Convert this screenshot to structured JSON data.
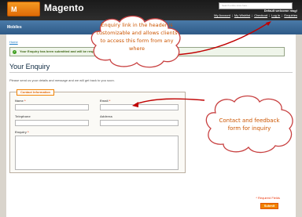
{
  "header": {
    "logo_text": "Magento",
    "search_placeholder": "Search entire store here...",
    "welcome": "Default welcome msg!",
    "links": [
      "My Account",
      "My Wishlist",
      "Checkout",
      "Log In",
      "Enquiries"
    ]
  },
  "nav": {
    "items": [
      "Mobiles"
    ]
  },
  "breadcrumb": {
    "home": "Home"
  },
  "messages": {
    "success": "Your Enquiry has been submitted and will be responded to as soon as possible."
  },
  "page": {
    "title": "Your Enquiry",
    "intro": "Please send us your details and message and we will get back to you soon."
  },
  "form": {
    "legend": "Contact Information",
    "name_label": "Name",
    "email_label": "Email",
    "telephone_label": "Telephone",
    "address_label": "Address",
    "enquiry_label": "Enquiry",
    "required_mark": "*",
    "required_note": "* Required Fields",
    "submit_label": "Submit"
  },
  "callouts": {
    "top": "Enquiry link in the header is customizable and allows clients to access this form from any where",
    "right": "Contact and feedback form for inquiry"
  },
  "colors": {
    "header_bg": "#1a1a1a",
    "nav_bg": "#2e5a87",
    "accent_orange": "#f18200",
    "callout_text": "#cc5500",
    "arrow": "#c00000"
  }
}
